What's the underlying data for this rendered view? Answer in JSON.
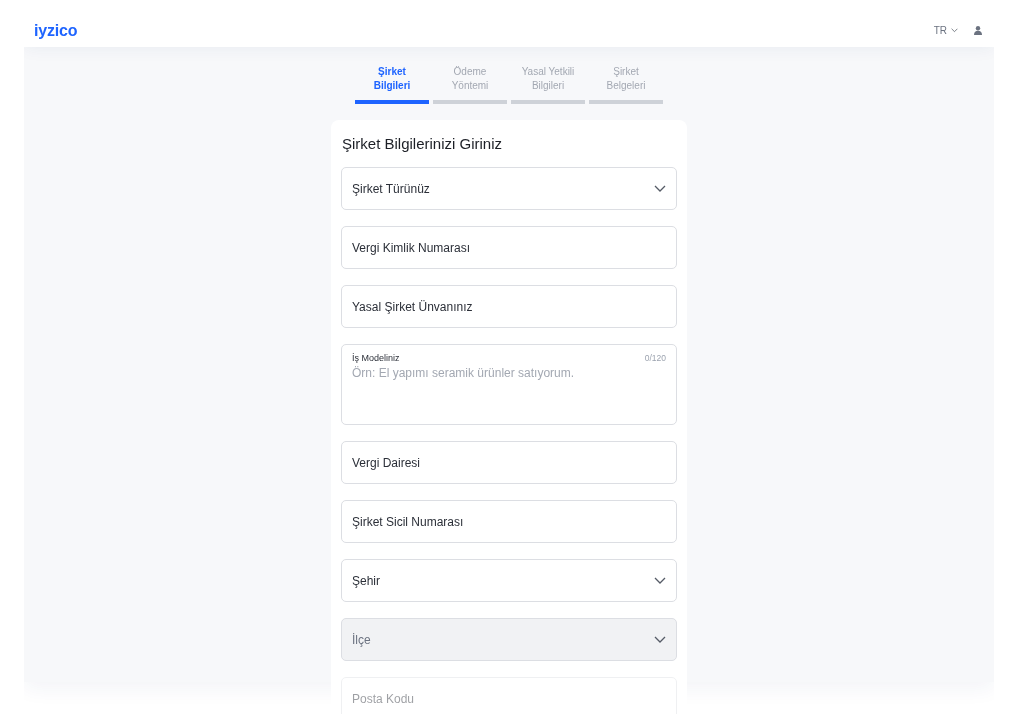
{
  "header": {
    "logo": "iyzico",
    "language": "TR"
  },
  "steps": [
    {
      "label": "Şirket Bilgileri",
      "selected": true
    },
    {
      "label": "Ödeme Yöntemi",
      "selected": false
    },
    {
      "label": "Yasal Yetkili Bilgileri",
      "selected": false
    },
    {
      "label": "Şirket Belgeleri",
      "selected": false
    }
  ],
  "form": {
    "title": "Şirket Bilgilerinizi Giriniz",
    "fields": [
      {
        "kind": "select",
        "placeholder": "Şirket Türünüz",
        "disabled": false,
        "faded": false
      },
      {
        "kind": "text",
        "placeholder": "Vergi Kimlik Numarası",
        "disabled": false,
        "faded": false
      },
      {
        "kind": "text",
        "placeholder": "Yasal Şirket Ünvanınız",
        "disabled": false,
        "faded": false
      },
      {
        "kind": "textarea",
        "label": "İş Modeliniz",
        "counter": "0/120",
        "placeholder": "Örn: El yapımı seramik ürünler satıyorum.",
        "disabled": false,
        "faded": false
      },
      {
        "kind": "text",
        "placeholder": "Vergi Dairesi",
        "disabled": false,
        "faded": false
      },
      {
        "kind": "text",
        "placeholder": "Şirket Sicil Numarası",
        "disabled": false,
        "faded": false
      },
      {
        "kind": "select",
        "placeholder": "Şehir",
        "disabled": false,
        "faded": false
      },
      {
        "kind": "select",
        "placeholder": "İlçe",
        "disabled": true,
        "faded": false
      },
      {
        "kind": "text",
        "placeholder": "Posta Kodu",
        "disabled": false,
        "faded": true
      }
    ]
  }
}
